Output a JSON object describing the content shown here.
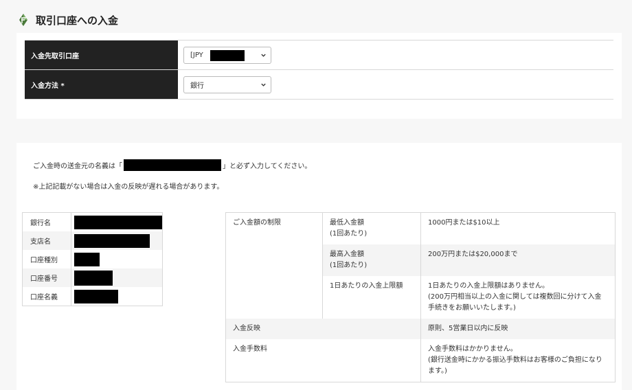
{
  "page": {
    "title": "取引口座への入金"
  },
  "form": {
    "account_label": "入金先取引口座",
    "account_value": "[JPY",
    "method_label": "入金方法",
    "method_required": "*",
    "method_value": "銀行"
  },
  "notice": {
    "line1_prefix": "ご入金時の送金元の名義は「",
    "line1_suffix": "」と必ず入力してください。",
    "line2": "※上記記載がない場合は入金の反映が遅れる場合があります。"
  },
  "bank": {
    "rows": [
      {
        "label": "銀行名"
      },
      {
        "label": "支店名"
      },
      {
        "label": "口座種別"
      },
      {
        "label": "口座番号"
      },
      {
        "label": "口座名義"
      }
    ]
  },
  "limits": {
    "section_label": "ご入金額の制限",
    "min_label_1": "最低入金額",
    "min_label_2": "(1回あたり)",
    "min_value": "1000円または$10以上",
    "max_label_1": "最高入金額",
    "max_label_2": "(1回あたり)",
    "max_value": "200万円または$20,000まで",
    "daily_label": "1日あたりの入金上限額",
    "daily_value_1": "1日あたりの入金上限額はありません。",
    "daily_value_2": "(200万円相当以上の入金に関しては複数回に分けて入金手続きをお願いいたします。)",
    "reflect_label": "入金反映",
    "reflect_value": "原則、5営業日以内に反映",
    "fee_label": "入金手数料",
    "fee_value_1": "入金手数料はかかりません。",
    "fee_value_2": "(銀行送金時にかかる振込手数料はお客様のご負担になります。)"
  },
  "colors": {
    "header_bg": "#222222",
    "page_bg": "#f7f7f7",
    "logo_green": "#4a7a3a"
  },
  "icons": {
    "logo": "leaf-logo-icon",
    "dropdown": "chevron-down-icon"
  }
}
